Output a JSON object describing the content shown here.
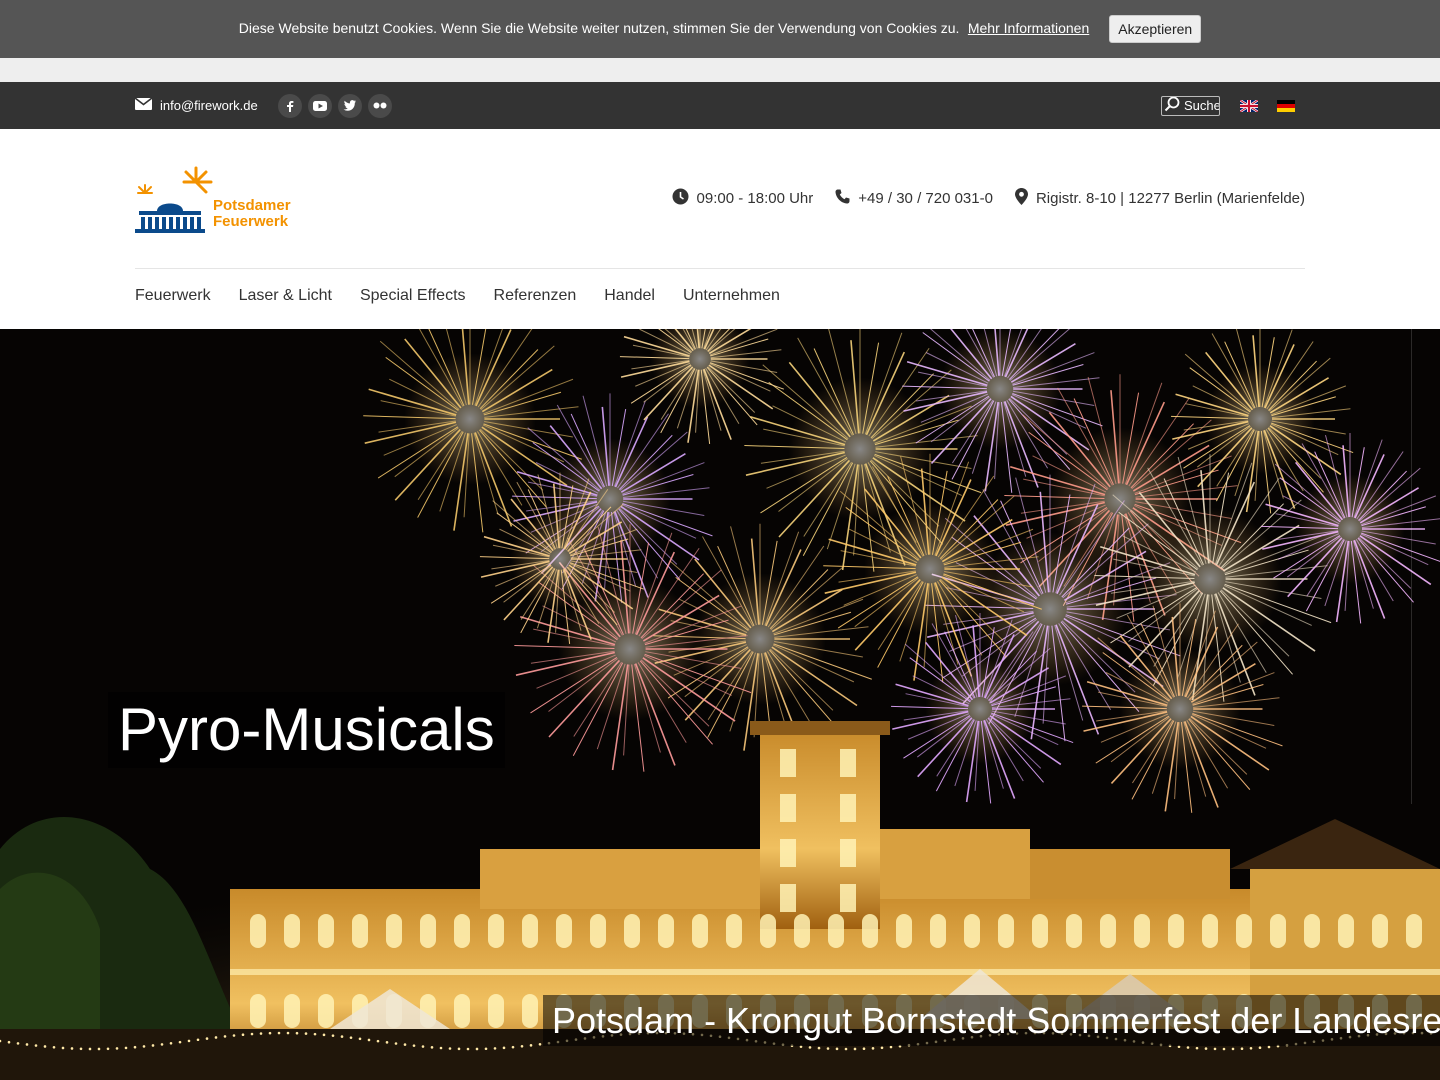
{
  "cookie": {
    "text": "Diese Website benutzt Cookies. Wenn Sie die Website weiter nutzen, stimmen Sie der Verwendung von Cookies zu.",
    "link": "Mehr Informationen",
    "accept": "Akzeptieren"
  },
  "topbar": {
    "email": "info@firework.de",
    "socials": [
      "facebook-icon",
      "youtube-icon",
      "twitter-icon",
      "flickr-icon"
    ],
    "search_label": "Suche",
    "languages": [
      "English",
      "Deutsch"
    ]
  },
  "header": {
    "logo_line1": "Potsdamer",
    "logo_line2": "Feuerwerk",
    "hours": "09:00 - 18:00 Uhr",
    "phone": "+49 / 30 / 720 031-0",
    "address": "Rigistr. 8-10 | 12277 Berlin (Marienfelde)"
  },
  "nav": [
    "Feuerwerk",
    "Laser & Licht",
    "Special Effects",
    "Referenzen",
    "Handel",
    "Unternehmen"
  ],
  "hero": {
    "title": "Pyro-Musicals",
    "caption": "Potsdam - Krongut Bornstedt Sommerfest der Landesre"
  },
  "colors": {
    "brand_orange": "#f39200",
    "brand_blue": "#0b4a8b",
    "topbar": "#333333",
    "cookie_bar": "#555555"
  }
}
